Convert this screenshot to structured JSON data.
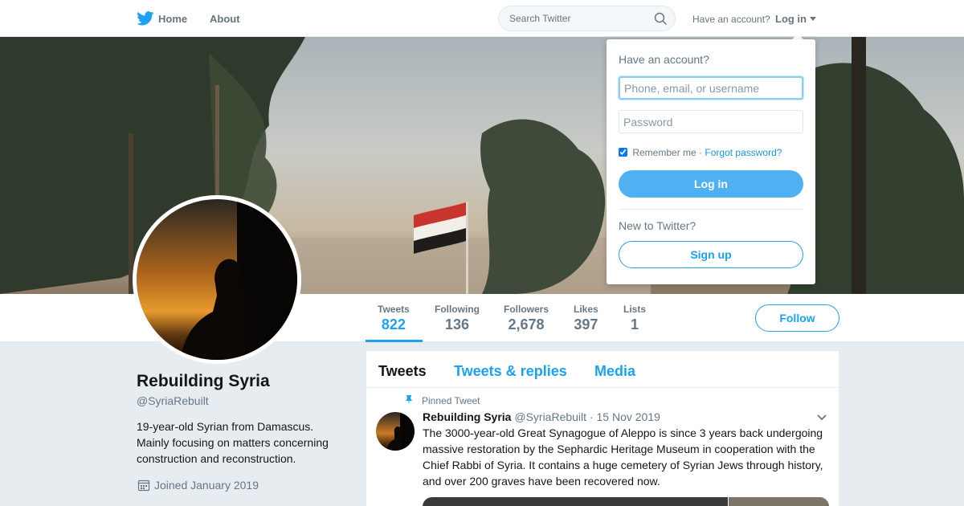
{
  "nav": {
    "home_label": "Home",
    "about_label": "About",
    "search_placeholder": "Search Twitter",
    "have_account_label": "Have an account?",
    "login_label": "Log in",
    "icons": {
      "logo": "twitter-bird-icon",
      "search": "search-icon",
      "caret": "caret-down-icon"
    }
  },
  "colors": {
    "accent": "#1da1f2",
    "login_button": "#50b1f2",
    "page_background": "#e6ecf0"
  },
  "profile": {
    "name": "Rebuilding Syria",
    "handle": "@SyriaRebuilt",
    "bio": "19-year-old Syrian from Damascus.\nMainly focusing on matters concerning\nconstruction and reconstruction.",
    "joined": "Joined January 2019"
  },
  "stats": [
    {
      "label": "Tweets",
      "value": "822"
    },
    {
      "label": "Following",
      "value": "136"
    },
    {
      "label": "Followers",
      "value": "2,678"
    },
    {
      "label": "Likes",
      "value": "397"
    },
    {
      "label": "Lists",
      "value": "1"
    }
  ],
  "follow_label": "Follow",
  "timeline": {
    "tabs": [
      "Tweets",
      "Tweets & replies",
      "Media"
    ],
    "pinned_label": "Pinned Tweet",
    "tweet": {
      "name": "Rebuilding Syria",
      "handle": "@SyriaRebuilt",
      "separator": "·",
      "date": "15 Nov 2019",
      "text": "The 3000-year-old Great Synagogue of Aleppo is since 3 years back undergoing massive restoration by the Sephardic Heritage Museum in cooperation with the Chief Rabbi of Syria. It contains a huge cemetery of Syrian Jews through history, and over 200 graves have been recovered now."
    }
  },
  "login_dropdown": {
    "title": "Have an account?",
    "username_placeholder": "Phone, email, or username",
    "password_placeholder": "Password",
    "remember_label": "Remember me",
    "separator": "·",
    "forgot_label": "Forgot password?",
    "login_button": "Log in",
    "new_label": "New to Twitter?",
    "signup_button": "Sign up"
  }
}
